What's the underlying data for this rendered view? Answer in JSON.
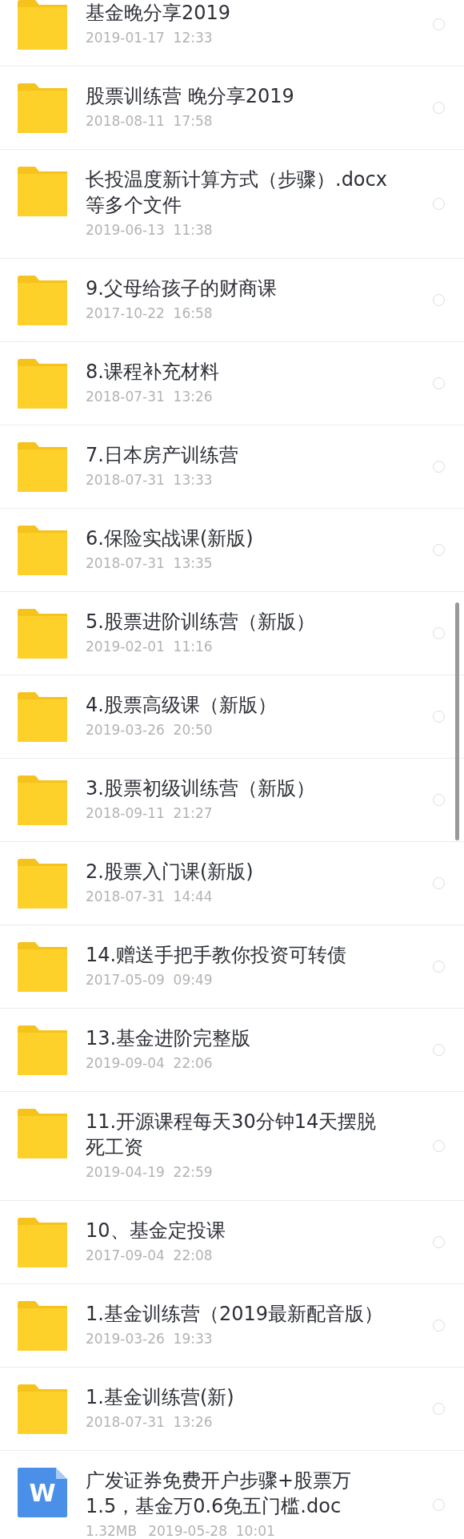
{
  "files": [
    {
      "kind": "folder",
      "name": "基金晚分享2019",
      "date": "2019-01-17  12:33",
      "selected": false
    },
    {
      "kind": "folder",
      "name": "股票训练营 晚分享2019",
      "date": "2018-08-11  17:58",
      "selected": false
    },
    {
      "kind": "folder",
      "name": "长投温度新计算方式（步骤）.docx等多个文件",
      "date": "2019-06-13  11:38",
      "selected": false
    },
    {
      "kind": "folder",
      "name": "9.父母给孩子的财商课",
      "date": "2017-10-22  16:58",
      "selected": false
    },
    {
      "kind": "folder",
      "name": "8.课程补充材料",
      "date": "2018-07-31  13:26",
      "selected": false
    },
    {
      "kind": "folder",
      "name": "7.日本房产训练营",
      "date": "2018-07-31  13:33",
      "selected": false
    },
    {
      "kind": "folder",
      "name": "6.保险实战课(新版)",
      "date": "2018-07-31  13:35",
      "selected": false
    },
    {
      "kind": "folder",
      "name": "5.股票进阶训练营（新版）",
      "date": "2019-02-01  11:16",
      "selected": false
    },
    {
      "kind": "folder",
      "name": "4.股票高级课（新版）",
      "date": "2019-03-26  20:50",
      "selected": false
    },
    {
      "kind": "folder",
      "name": "3.股票初级训练营（新版）",
      "date": "2018-09-11  21:27",
      "selected": false
    },
    {
      "kind": "folder",
      "name": "2.股票入门课(新版)",
      "date": "2018-07-31  14:44",
      "selected": false
    },
    {
      "kind": "folder",
      "name": "14.赠送手把手教你投资可转债",
      "date": "2017-05-09  09:49",
      "selected": false
    },
    {
      "kind": "folder",
      "name": "13.基金进阶完整版",
      "date": "2019-09-04  22:06",
      "selected": false
    },
    {
      "kind": "folder",
      "name": "11.开源课程每天30分钟14天摆脱死工资",
      "date": "2019-04-19  22:59",
      "selected": false
    },
    {
      "kind": "folder",
      "name": "10、基金定投课",
      "date": "2017-09-04  22:08",
      "selected": false
    },
    {
      "kind": "folder",
      "name": "1.基金训练营（2019最新配音版）",
      "date": "2019-03-26  19:33",
      "selected": false
    },
    {
      "kind": "folder",
      "name": "1.基金训练营(新)",
      "date": "2018-07-31  13:26",
      "selected": false
    },
    {
      "kind": "doc",
      "icon_text": "W",
      "name": "广发证券免费开户步骤+股票万1.5，基金万0.6免五门槛.doc",
      "size": "1.32MB",
      "date": "2019-05-28  10:01",
      "selected": false
    }
  ]
}
